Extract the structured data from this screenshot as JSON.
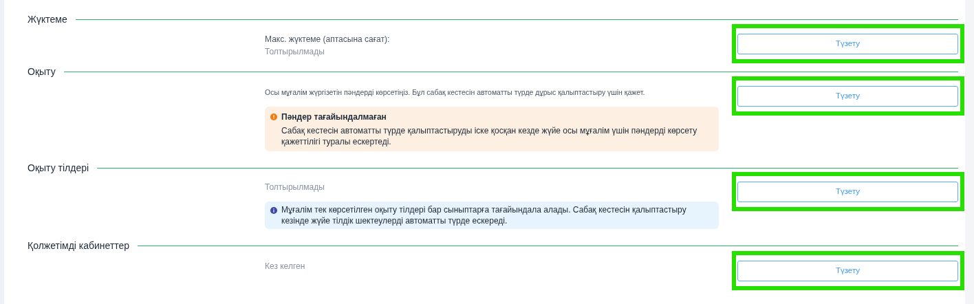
{
  "sections": [
    {
      "title": "Жүктеме",
      "blocks": [
        {
          "kind": "label",
          "text": "Макс. жүктеме (аптасына сағат):"
        },
        {
          "kind": "value",
          "text": "Толтырылмады"
        }
      ],
      "button": {
        "label": "Түзету",
        "highlighted": true
      }
    },
    {
      "title": "Оқыту",
      "blocks": [
        {
          "kind": "note",
          "text": "Осы мұғалім жүргізетін пәндерді көрсетіңіз. Бұл сабақ кестесін автоматты түрде дұрыс қалыптастыру үшін қажет."
        },
        {
          "kind": "warning",
          "title": "Пәндер тағайындалмаған",
          "text": "Сабақ кестесін автоматты түрде қалыптастыруды іске қосқан кезде жүйе осы мұғалім үшін пәндерді көрсету қажеттілігі туралы ескертеді."
        }
      ],
      "button": {
        "label": "Түзету",
        "highlighted": true
      }
    },
    {
      "title": "Оқыту тілдері",
      "blocks": [
        {
          "kind": "value",
          "text": "Толтырылмады"
        },
        {
          "kind": "info",
          "text": "Мұғалім тек көрсетілген оқыту тілдері бар сыныптарға тағайындала алады. Сабақ кестесін қалыптастыру кезінде жүйе тілдік шектеулерді автоматты түрде ескереді."
        }
      ],
      "button": {
        "label": "Түзету",
        "highlighted": true
      }
    },
    {
      "title": "Қолжетімді кабинеттер",
      "blocks": [
        {
          "kind": "value",
          "text": "Кез келген"
        }
      ],
      "button": {
        "label": "Түзету",
        "highlighted": true
      }
    }
  ]
}
